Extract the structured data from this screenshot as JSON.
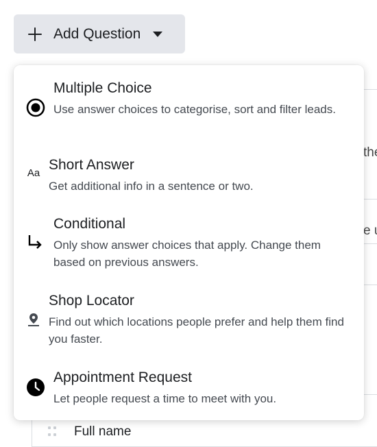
{
  "toolbar": {
    "add_question_label": "Add Question"
  },
  "background": {
    "peek_1": "the",
    "peek_2": "e u",
    "field_label": "Full name"
  },
  "menu": {
    "items": [
      {
        "icon": "radio-selected-icon",
        "title": "Multiple Choice",
        "description": "Use answer choices to categorise, sort and filter leads."
      },
      {
        "icon": "text-aa-icon",
        "icon_text": "Aa",
        "title": "Short Answer",
        "description": "Get additional info in a sentence or two."
      },
      {
        "icon": "branch-arrow-icon",
        "title": "Conditional",
        "description": "Only show answer choices that apply. Change them based on previous answers."
      },
      {
        "icon": "location-pin-icon",
        "title": "Shop Locator",
        "description": "Find out which locations people prefer and help them find you faster."
      },
      {
        "icon": "clock-icon",
        "title": "Appointment Request",
        "description": "Let people request a time to meet with you."
      }
    ]
  },
  "colors": {
    "button_bg": "#e4e6eb",
    "text_primary": "#1c1e21",
    "text_secondary": "#444950",
    "border": "#dadde1"
  }
}
